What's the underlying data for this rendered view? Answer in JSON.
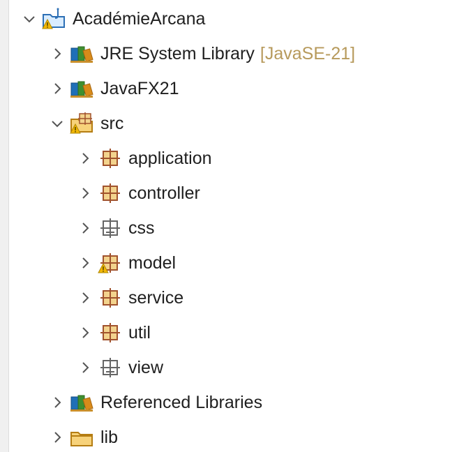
{
  "tree": {
    "project": {
      "label": "AcadémieArcana",
      "expanded": true,
      "icon": "java-project-warning-icon"
    },
    "jre": {
      "label": "JRE System Library",
      "decoration": "[JavaSE-21]",
      "expanded": false,
      "icon": "library-icon"
    },
    "javafx": {
      "label": "JavaFX21",
      "expanded": false,
      "icon": "library-icon"
    },
    "src": {
      "label": "src",
      "expanded": true,
      "icon": "source-folder-warning-icon"
    },
    "packages": [
      {
        "label": "application",
        "icon": "package-icon"
      },
      {
        "label": "controller",
        "icon": "package-icon"
      },
      {
        "label": "css",
        "icon": "empty-package-icon"
      },
      {
        "label": "model",
        "icon": "package-warning-icon"
      },
      {
        "label": "service",
        "icon": "package-icon"
      },
      {
        "label": "util",
        "icon": "package-icon"
      },
      {
        "label": "view",
        "icon": "empty-package-icon"
      }
    ],
    "referenced": {
      "label": "Referenced Libraries",
      "expanded": false,
      "icon": "library-icon"
    },
    "lib": {
      "label": "lib",
      "expanded": false,
      "icon": "folder-icon"
    }
  },
  "colors": {
    "package": "#a0522d",
    "package_fill": "#f3d38d",
    "library_blue": "#1f6fb7",
    "library_green": "#3f8f2f",
    "library_orange": "#d98b1a",
    "folder": "#e8b64b",
    "warning": "#f2b705",
    "decoration": "#b79a5c"
  }
}
